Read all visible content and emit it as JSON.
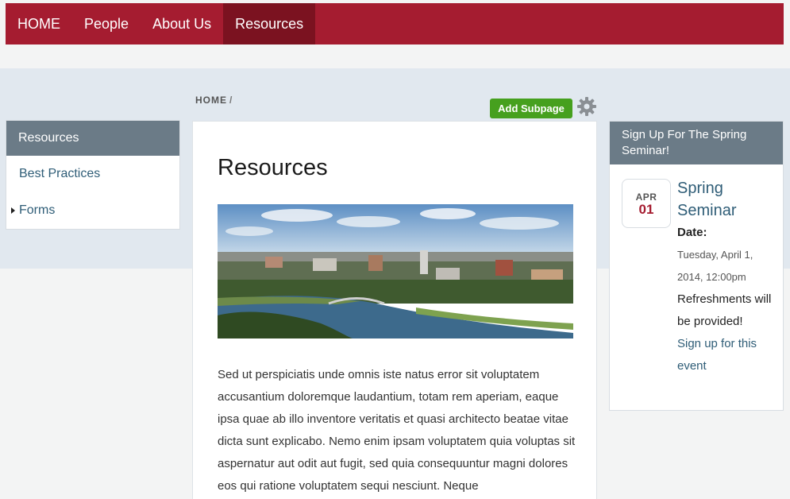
{
  "nav": {
    "items": [
      {
        "label": "HOME"
      },
      {
        "label": "People"
      },
      {
        "label": "About Us"
      },
      {
        "label": "Resources"
      }
    ]
  },
  "breadcrumb": {
    "home": "HOME",
    "sep": "/"
  },
  "toolbar": {
    "add_subpage": "Add Subpage"
  },
  "sidebar": {
    "title": "Resources",
    "items": [
      {
        "label": "Best Practices"
      },
      {
        "label": "Forms"
      }
    ]
  },
  "main": {
    "title": "Resources",
    "body": "Sed ut perspiciatis unde omnis iste natus error sit voluptatem accusantium doloremque laudantium, totam rem aperiam, eaque ipsa quae ab illo inventore veritatis et quasi architecto beatae vitae dicta sunt explicabo. Nemo enim ipsam voluptatem quia voluptas sit aspernatur aut odit aut fugit, sed quia consequuntur magni dolores eos qui ratione voluptatem sequi nesciunt. Neque"
  },
  "event_box": {
    "title": "Sign Up For The Spring Seminar!",
    "month": "APR",
    "day": "01",
    "event_title": "Spring Seminar",
    "date_label": "Date:",
    "date_value": "Tuesday, April 1, 2014, 12:00pm",
    "note": "Refreshments will be provided!",
    "signup": "Sign up for this event"
  },
  "colors": {
    "brand": "#a51c30",
    "button_green": "#46a01e",
    "header_slate": "#6b7b87",
    "link": "#2f5d77"
  }
}
